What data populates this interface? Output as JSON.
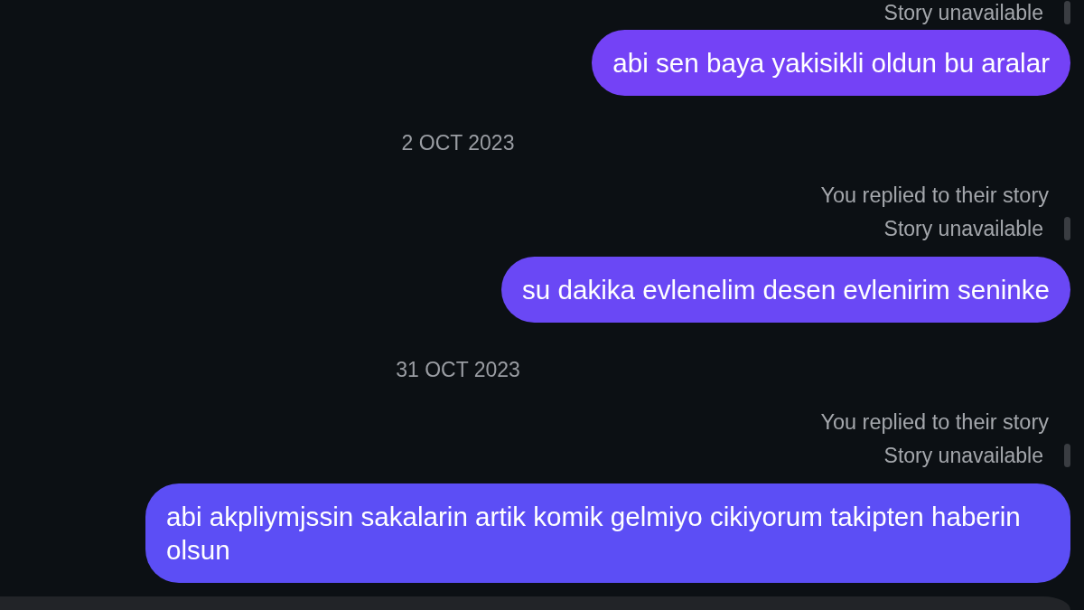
{
  "thread": [
    {
      "kind": "story_status",
      "text": "Story unavailable"
    },
    {
      "kind": "bubble",
      "text": "abi sen baya yakisikli oldun bu aralar",
      "color": "#7442f6"
    },
    {
      "kind": "date",
      "text": "2 OCT 2023"
    },
    {
      "kind": "reply_note",
      "text": "You replied to their story"
    },
    {
      "kind": "story_status",
      "text": "Story unavailable"
    },
    {
      "kind": "bubble",
      "text": "su dakika evlenelim desen evlenirim seninke",
      "color": "#6a48f5"
    },
    {
      "kind": "date",
      "text": "31 OCT 2023"
    },
    {
      "kind": "reply_note",
      "text": "You replied to their story"
    },
    {
      "kind": "story_status",
      "text": "Story unavailable"
    },
    {
      "kind": "bubble",
      "text": "abi akpliymjssin sakalarin artik komik gelmiyo cikiyorum takipten haberin olsun",
      "color": "#5c4ef5"
    }
  ]
}
